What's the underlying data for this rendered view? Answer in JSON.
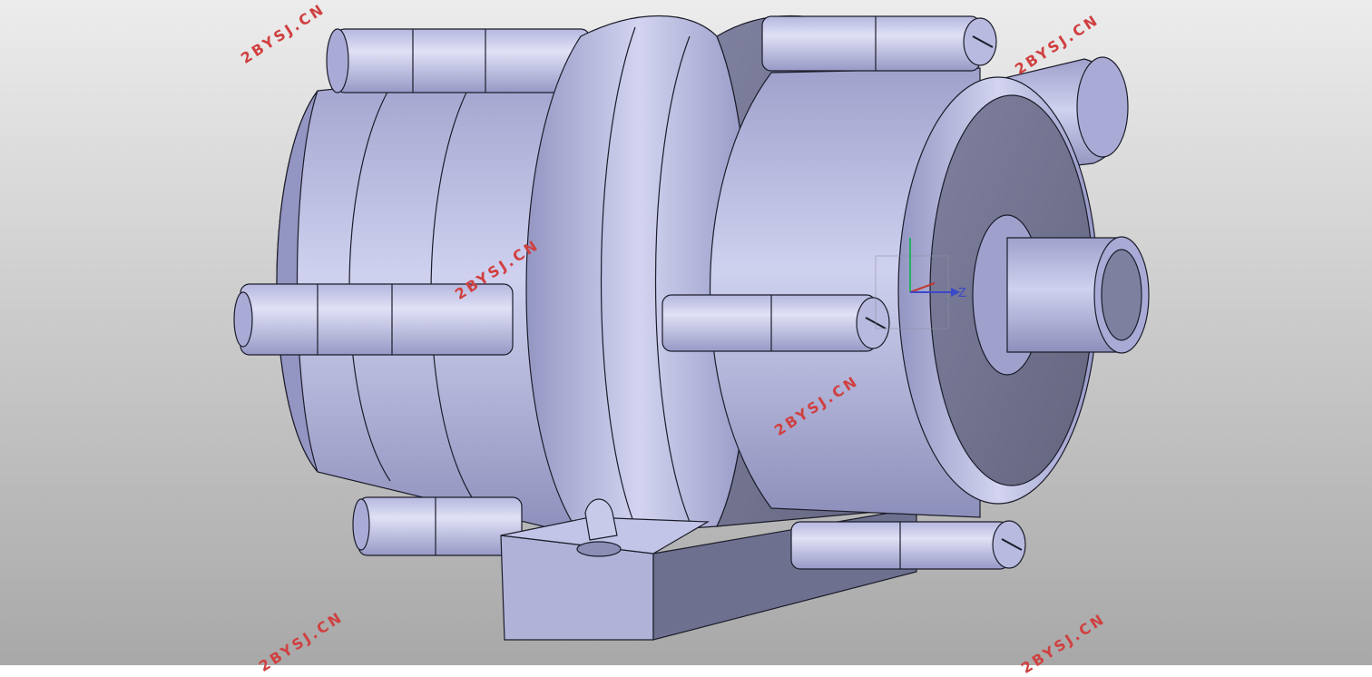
{
  "viewport": {
    "background_top": "#ececec",
    "background_bottom": "#a8a8a8",
    "part_color": "#a7a9d2",
    "part_light": "#c9cbea",
    "part_dark": "#6e7090",
    "edge_color": "#1c1c2a"
  },
  "triad": {
    "z_label": "Z",
    "x_color": "#c0392b",
    "y_color": "#27ae60",
    "z_color": "#3b48c8"
  },
  "watermark": {
    "text": "2BYSJ.CN",
    "color": "#d04040"
  }
}
